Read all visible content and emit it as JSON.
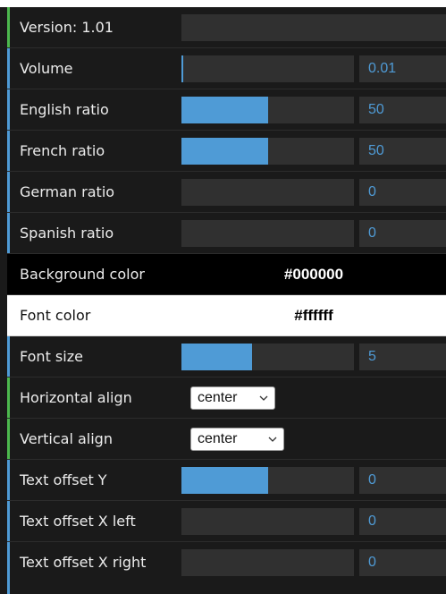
{
  "colors": {
    "accent_green": "#4cb84e",
    "accent_blue": "#4f9bd6",
    "slider_fill": "#4f9bd6",
    "number_text": "#4f9bd6",
    "panel_bg": "#1a1a1a",
    "field_bg": "#303030"
  },
  "version": {
    "label": "Version: 1.01"
  },
  "controls": {
    "volume": {
      "label": "Volume",
      "value": "0.01",
      "fraction": 0.005
    },
    "english_ratio": {
      "label": "English ratio",
      "value": "50",
      "fraction": 0.5
    },
    "french_ratio": {
      "label": "French ratio",
      "value": "50",
      "fraction": 0.5
    },
    "german_ratio": {
      "label": "German ratio",
      "value": "0",
      "fraction": 0
    },
    "spanish_ratio": {
      "label": "Spanish ratio",
      "value": "0",
      "fraction": 0
    },
    "background_color": {
      "label": "Background color",
      "value": "#000000"
    },
    "font_color": {
      "label": "Font color",
      "value": "#ffffff"
    },
    "font_size": {
      "label": "Font size",
      "value": "5",
      "fraction": 0.41
    },
    "horizontal_align": {
      "label": "Horizontal align",
      "value": "center",
      "icon": "chevron-down-icon"
    },
    "vertical_align": {
      "label": "Vertical align",
      "value": "center",
      "icon": "chevron-down-icon"
    },
    "text_offset_y": {
      "label": "Text offset Y",
      "value": "0",
      "fraction": 0.5
    },
    "text_offset_x_left": {
      "label": "Text offset X left",
      "value": "0",
      "fraction": 0
    },
    "text_offset_x_right": {
      "label": "Text offset X right",
      "value": "0",
      "fraction": 0
    }
  }
}
